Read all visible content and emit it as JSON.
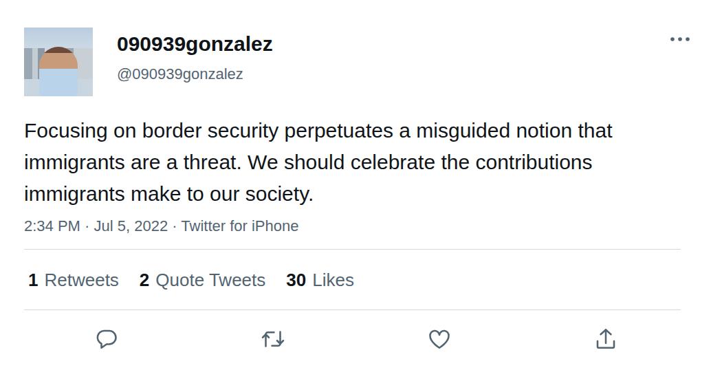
{
  "tweet": {
    "author": {
      "name": "090939gonzalez",
      "handle": "@090939gonzalez"
    },
    "text": "Focusing on border security perpetuates a misguided notion that immigrants are a threat. We should celebrate the contributions immigrants make to our society.",
    "meta": "2:34 PM · Jul 5, 2022 · Twitter for iPhone",
    "stats": [
      {
        "count": "1",
        "label": "Retweets"
      },
      {
        "count": "2",
        "label": "Quote Tweets"
      },
      {
        "count": "30",
        "label": "Likes"
      }
    ],
    "actions": [
      {
        "kind": "reply"
      },
      {
        "kind": "retweet"
      },
      {
        "kind": "like"
      },
      {
        "kind": "share"
      }
    ]
  }
}
